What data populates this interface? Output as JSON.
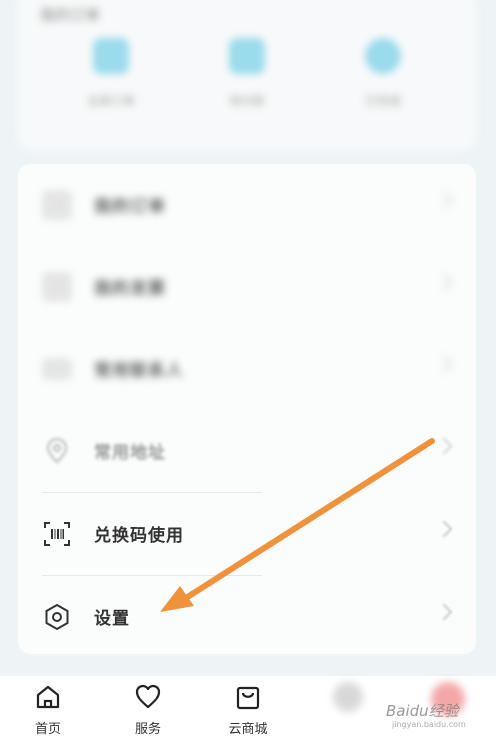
{
  "top_section": {
    "title": "我的订单",
    "items": [
      {
        "label": "全部订单",
        "icon": "order-icon"
      },
      {
        "label": "待付款",
        "icon": "payment-icon"
      },
      {
        "label": "已完成",
        "icon": "done-icon"
      }
    ]
  },
  "menu": {
    "items": [
      {
        "label": "我的订单",
        "icon": "list-icon"
      },
      {
        "label": "我的发票",
        "icon": "invoice-icon"
      },
      {
        "label": "常用联系人",
        "icon": "contacts-icon"
      },
      {
        "label": "常用地址",
        "icon": "location-pin-icon"
      },
      {
        "label": "兑换码使用",
        "icon": "barcode-scan-icon"
      },
      {
        "label": "设置",
        "icon": "hexagon-settings-icon"
      }
    ]
  },
  "bottom_nav": {
    "items": [
      {
        "label": "首页",
        "icon": "home-icon"
      },
      {
        "label": "服务",
        "icon": "heart-icon"
      },
      {
        "label": "云商城",
        "icon": "shopping-bag-icon"
      }
    ]
  },
  "annotation": {
    "color": "#f0913c"
  },
  "watermark": {
    "text": "Baidu经验",
    "sub": "jingyan.baidu.com"
  },
  "colors": {
    "accent_cyan": "#7fd3ea",
    "background": "#eef3f5"
  }
}
